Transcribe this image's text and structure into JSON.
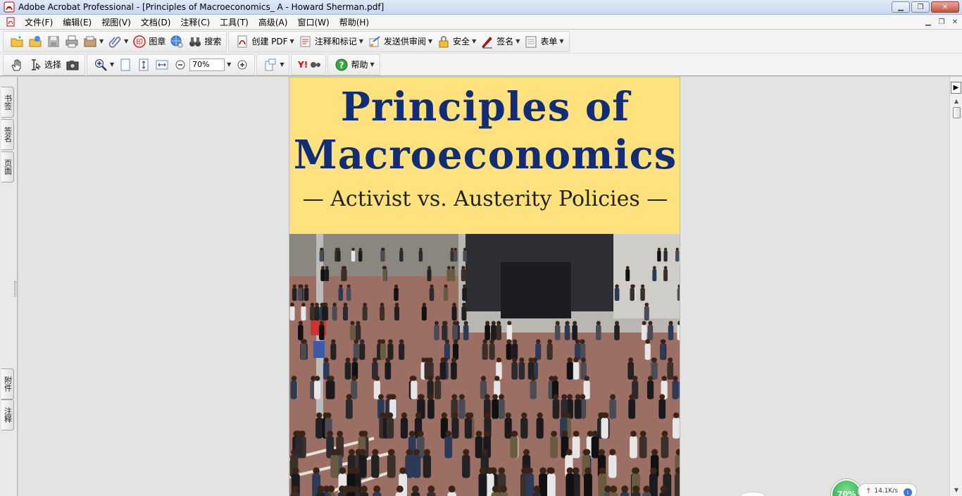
{
  "window": {
    "title": "Adobe Acrobat Professional - [Principles of Macroeconomics_ A - Howard Sherman.pdf]",
    "controls": [
      "minimize",
      "restore",
      "close"
    ]
  },
  "menubar": {
    "items": [
      "文件(F)",
      "编辑(E)",
      "视图(V)",
      "文档(D)",
      "注释(C)",
      "工具(T)",
      "高级(A)",
      "窗口(W)",
      "帮助(H)"
    ]
  },
  "toolbar1": {
    "stamp_label": "图章",
    "search_label": "搜索",
    "create_pdf_label": "创建 PDF",
    "comment_label": "注释和标记",
    "review_label": "发送供审阅",
    "security_label": "安全",
    "sign_label": "签名",
    "forms_label": "表单"
  },
  "toolbar2": {
    "select_label": "选择",
    "zoom_value": "70%",
    "help_label": "帮助"
  },
  "side_tabs": {
    "bookmarks": "书签",
    "signatures": "签名",
    "pages": "页面",
    "attachments": "附件",
    "comments": "注释"
  },
  "document": {
    "title_line1": "Principles of",
    "title_line2": "Macroeconomics",
    "subtitle": "— Activist vs. Austerity Policies —"
  },
  "net_widget": {
    "percent": "70%",
    "speed": "14.1K/s"
  },
  "colors": {
    "cover_yellow": "#ffe27e",
    "title_blue": "#122d78",
    "doc_background": "#e3e3e3"
  }
}
